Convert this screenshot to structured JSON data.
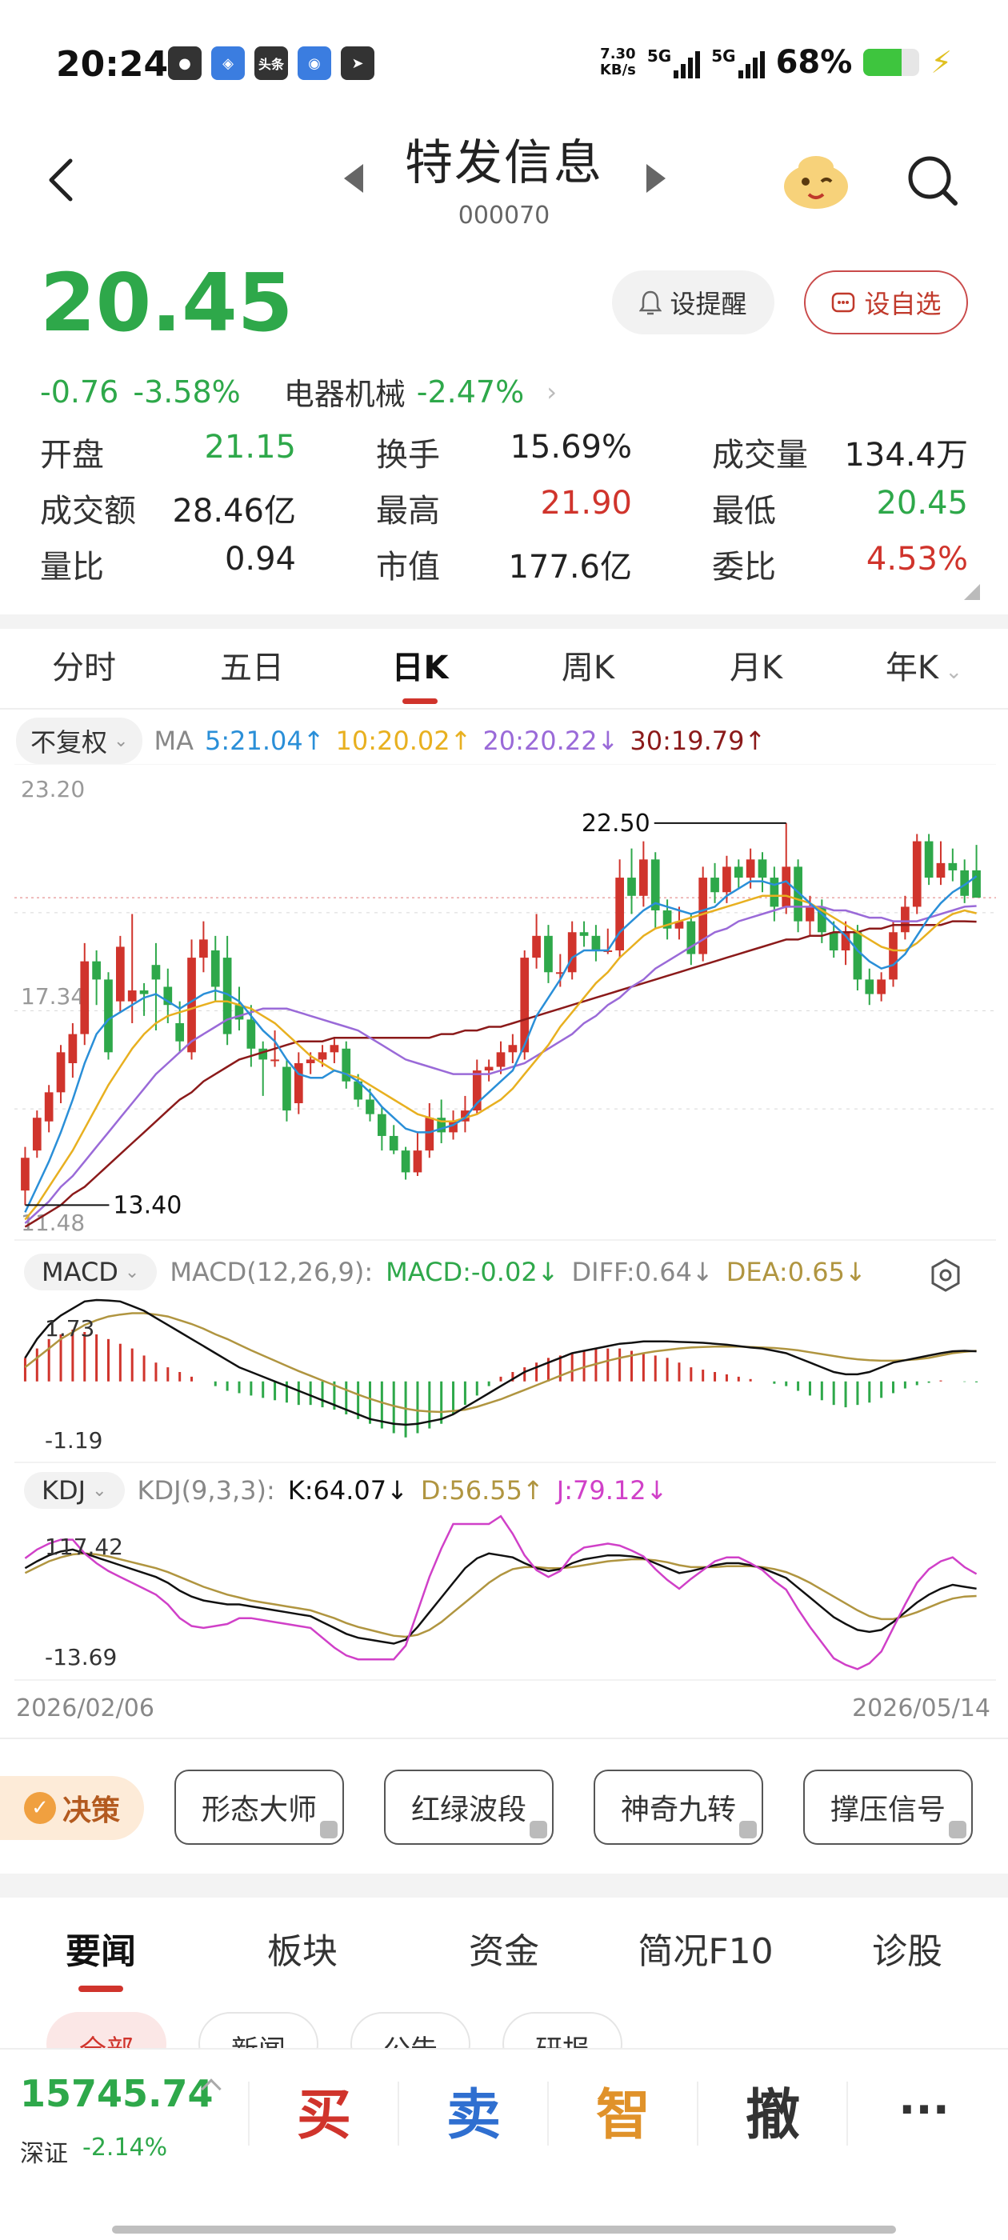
{
  "status_bar": {
    "time": "20:24",
    "net_speed_value": "7.30",
    "net_speed_unit": "KB/s",
    "signal1": "5G",
    "signal2": "5G",
    "battery_percent": "68%",
    "battery_level": 0.68,
    "apps": [
      "wechat-icon",
      "alipay-icon",
      "toutiao-icon",
      "browser-icon",
      "telegram-icon"
    ],
    "toutiao_label": "头条"
  },
  "header": {
    "name": "特发信息",
    "code": "000070"
  },
  "quote": {
    "price": "20.45",
    "change": "-0.76",
    "change_pct": "-3.58%",
    "sector": "电器机械",
    "sector_pct": "-2.47%",
    "alert_label": "设提醒",
    "watch_label": "设自选"
  },
  "stats": [
    [
      {
        "label": "开盘",
        "value": "21.15",
        "color": "green"
      },
      {
        "label": "换手",
        "value": "15.69%",
        "color": "dark"
      },
      {
        "label": "成交量",
        "value": "134.4万",
        "color": "dark"
      }
    ],
    [
      {
        "label": "成交额",
        "value": "28.46亿",
        "color": "dark"
      },
      {
        "label": "最高",
        "value": "21.90",
        "color": "red"
      },
      {
        "label": "最低",
        "value": "20.45",
        "color": "green"
      }
    ],
    [
      {
        "label": "量比",
        "value": "0.94",
        "color": "dark"
      },
      {
        "label": "市值",
        "value": "177.6亿",
        "color": "dark"
      },
      {
        "label": "委比",
        "value": "4.53%",
        "color": "red"
      }
    ]
  ],
  "period_tabs": [
    "分时",
    "五日",
    "日K",
    "周K",
    "月K",
    "年K"
  ],
  "active_period": "日K",
  "ma": {
    "adj": "不复权",
    "label": "MA",
    "ma5": "5:21.04↑",
    "ma10": "10:20.02↑",
    "ma20": "20:20.22↓",
    "ma30": "30:19.79↑"
  },
  "chart_data": {
    "type": "candlestick",
    "price_axis": {
      "top": "23.20",
      "mid": "17.34",
      "bottom": "11.48",
      "min": 11.48,
      "max": 23.2
    },
    "high_label": "22.50",
    "low_label": "13.40",
    "candles": [
      [
        12.4,
        13.3,
        12.0,
        13.6
      ],
      [
        13.5,
        14.4,
        13.3,
        14.6
      ],
      [
        14.3,
        15.1,
        14.0,
        15.3
      ],
      [
        15.1,
        16.2,
        14.8,
        16.4
      ],
      [
        15.9,
        16.7,
        15.5,
        17.0
      ],
      [
        16.7,
        18.7,
        16.4,
        19.2
      ],
      [
        18.7,
        18.2,
        17.5,
        19.0
      ],
      [
        18.2,
        16.2,
        16.0,
        18.4
      ],
      [
        17.6,
        19.1,
        17.3,
        19.4
      ],
      [
        17.6,
        17.9,
        17.0,
        20.0
      ],
      [
        17.9,
        17.8,
        17.2,
        18.1
      ],
      [
        18.6,
        18.2,
        16.8,
        19.2
      ],
      [
        18.0,
        17.5,
        17.0,
        18.5
      ],
      [
        17.0,
        16.5,
        16.2,
        17.6
      ],
      [
        16.2,
        18.8,
        16.0,
        19.3
      ],
      [
        18.8,
        19.3,
        18.4,
        19.8
      ],
      [
        19.0,
        18.0,
        17.6,
        19.4
      ],
      [
        18.8,
        16.7,
        16.4,
        19.4
      ],
      [
        17.5,
        17.1,
        16.8,
        18.0
      ],
      [
        17.1,
        16.3,
        15.8,
        17.5
      ],
      [
        16.3,
        16.0,
        15.0,
        16.5
      ],
      [
        16.0,
        16.0,
        15.8,
        16.8
      ],
      [
        15.8,
        14.6,
        14.3,
        16.0
      ],
      [
        14.8,
        15.9,
        14.5,
        16.2
      ],
      [
        15.9,
        16.0,
        15.6,
        16.2
      ],
      [
        16.0,
        16.2,
        15.8,
        16.4
      ],
      [
        16.2,
        16.4,
        15.9,
        16.6
      ],
      [
        16.3,
        15.4,
        15.2,
        16.5
      ],
      [
        15.4,
        14.9,
        14.7,
        15.6
      ],
      [
        14.9,
        14.5,
        14.3,
        15.2
      ],
      [
        14.5,
        13.9,
        13.5,
        14.7
      ],
      [
        13.9,
        13.5,
        13.4,
        14.2
      ],
      [
        13.5,
        12.9,
        12.7,
        13.6
      ],
      [
        12.9,
        13.5,
        12.8,
        14.0
      ],
      [
        13.5,
        14.4,
        13.3,
        14.8
      ],
      [
        14.4,
        14.0,
        13.7,
        14.9
      ],
      [
        14.0,
        14.3,
        13.8,
        14.6
      ],
      [
        14.3,
        14.6,
        14.0,
        15.0
      ],
      [
        14.6,
        15.7,
        14.5,
        16.0
      ],
      [
        15.7,
        15.8,
        15.4,
        16.0
      ],
      [
        15.8,
        16.2,
        15.6,
        16.5
      ],
      [
        16.2,
        16.4,
        15.9,
        16.7
      ],
      [
        16.2,
        18.8,
        16.0,
        19.0
      ],
      [
        18.8,
        19.4,
        18.5,
        20.0
      ],
      [
        19.4,
        18.4,
        18.1,
        19.7
      ],
      [
        18.4,
        18.4,
        18.0,
        18.9
      ],
      [
        18.4,
        19.5,
        18.2,
        19.8
      ],
      [
        19.5,
        19.4,
        19.1,
        19.8
      ],
      [
        19.4,
        19.0,
        18.7,
        19.7
      ],
      [
        19.0,
        19.0,
        18.9,
        19.6
      ],
      [
        19.0,
        21.0,
        18.8,
        21.5
      ],
      [
        21.0,
        20.5,
        20.0,
        21.8
      ],
      [
        20.5,
        21.5,
        20.2,
        22.0
      ],
      [
        21.5,
        20.1,
        19.6,
        21.7
      ],
      [
        20.1,
        19.6,
        19.3,
        20.4
      ],
      [
        19.6,
        19.8,
        19.3,
        20.2
      ],
      [
        19.8,
        18.9,
        18.6,
        20.0
      ],
      [
        18.9,
        21.0,
        18.7,
        21.3
      ],
      [
        21.0,
        20.6,
        20.3,
        21.4
      ],
      [
        20.6,
        21.3,
        20.3,
        21.6
      ],
      [
        21.3,
        21.0,
        20.7,
        21.5
      ],
      [
        21.0,
        21.5,
        20.7,
        21.8
      ],
      [
        21.5,
        21.0,
        20.6,
        21.7
      ],
      [
        21.0,
        20.2,
        19.8,
        21.3
      ],
      [
        20.2,
        21.3,
        20.0,
        22.5
      ],
      [
        21.3,
        19.8,
        19.5,
        21.5
      ],
      [
        19.8,
        20.2,
        19.4,
        20.5
      ],
      [
        20.2,
        19.5,
        19.2,
        20.4
      ],
      [
        19.5,
        19.0,
        18.8,
        19.8
      ],
      [
        19.0,
        19.5,
        18.6,
        19.8
      ],
      [
        19.5,
        18.2,
        17.9,
        19.7
      ],
      [
        18.2,
        17.8,
        17.5,
        18.5
      ],
      [
        17.8,
        18.2,
        17.6,
        18.4
      ],
      [
        18.2,
        19.5,
        18.0,
        19.8
      ],
      [
        19.5,
        20.2,
        19.3,
        20.5
      ],
      [
        20.2,
        22.0,
        20.0,
        22.2
      ],
      [
        22.0,
        21.0,
        20.8,
        22.2
      ],
      [
        21.0,
        21.4,
        20.8,
        22.0
      ],
      [
        21.4,
        21.2,
        20.9,
        21.8
      ],
      [
        21.2,
        20.5,
        20.3,
        21.5
      ],
      [
        21.2,
        20.45,
        20.45,
        21.9
      ]
    ],
    "ma5": [
      11.8,
      12.5,
      13.2,
      14.0,
      14.9,
      15.9,
      16.7,
      17.1,
      17.3,
      17.5,
      17.7,
      17.8,
      17.6,
      17.4,
      17.6,
      17.8,
      17.9,
      17.8,
      17.6,
      17.2,
      16.8,
      16.5,
      16.0,
      15.6,
      15.5,
      15.5,
      15.7,
      15.6,
      15.4,
      15.1,
      14.7,
      14.4,
      14.1,
      14.0,
      14.0,
      14.1,
      14.2,
      14.4,
      14.8,
      15.1,
      15.4,
      15.7,
      16.4,
      17.2,
      17.7,
      18.2,
      18.8,
      19.0,
      19.0,
      19.0,
      19.5,
      19.8,
      20.1,
      20.3,
      20.2,
      20.1,
      20.0,
      20.1,
      20.2,
      20.5,
      20.7,
      20.9,
      20.9,
      20.8,
      20.9,
      20.6,
      20.3,
      20.0,
      19.7,
      19.4,
      19.0,
      18.7,
      18.5,
      18.6,
      18.9,
      19.4,
      19.9,
      20.3,
      20.6,
      20.8,
      21.04
    ],
    "ma10": [
      11.6,
      12.0,
      12.5,
      13.0,
      13.5,
      14.1,
      14.7,
      15.3,
      15.8,
      16.3,
      16.7,
      17.0,
      17.2,
      17.3,
      17.4,
      17.5,
      17.6,
      17.6,
      17.5,
      17.4,
      17.2,
      17.0,
      16.7,
      16.4,
      16.1,
      15.9,
      15.7,
      15.6,
      15.5,
      15.3,
      15.1,
      14.9,
      14.7,
      14.5,
      14.4,
      14.3,
      14.3,
      14.4,
      14.5,
      14.7,
      14.9,
      15.2,
      15.6,
      16.0,
      16.4,
      16.9,
      17.3,
      17.7,
      18.1,
      18.4,
      18.8,
      19.1,
      19.4,
      19.6,
      19.7,
      19.8,
      19.9,
      20.0,
      20.1,
      20.2,
      20.3,
      20.4,
      20.5,
      20.5,
      20.5,
      20.4,
      20.3,
      20.1,
      19.9,
      19.7,
      19.5,
      19.3,
      19.1,
      19.0,
      19.0,
      19.2,
      19.5,
      19.8,
      20.0,
      20.1,
      20.02
    ],
    "ma20": [
      11.5,
      11.8,
      12.1,
      12.5,
      12.8,
      13.2,
      13.6,
      14.0,
      14.4,
      14.8,
      15.2,
      15.6,
      15.9,
      16.2,
      16.5,
      16.7,
      16.9,
      17.1,
      17.2,
      17.3,
      17.4,
      17.4,
      17.4,
      17.3,
      17.2,
      17.1,
      17.0,
      16.9,
      16.8,
      16.6,
      16.4,
      16.2,
      16.0,
      15.9,
      15.8,
      15.7,
      15.6,
      15.6,
      15.6,
      15.6,
      15.7,
      15.8,
      15.9,
      16.1,
      16.3,
      16.5,
      16.7,
      17.0,
      17.2,
      17.5,
      17.7,
      18.0,
      18.2,
      18.5,
      18.7,
      18.9,
      19.1,
      19.3,
      19.5,
      19.6,
      19.8,
      19.9,
      20.0,
      20.1,
      20.2,
      20.2,
      20.2,
      20.2,
      20.1,
      20.1,
      20.0,
      19.9,
      19.9,
      19.8,
      19.8,
      19.8,
      19.9,
      20.0,
      20.1,
      20.2,
      20.22
    ],
    "ma30": [
      11.4,
      11.6,
      11.8,
      12.0,
      12.3,
      12.5,
      12.8,
      13.1,
      13.4,
      13.7,
      14.0,
      14.3,
      14.6,
      14.9,
      15.1,
      15.4,
      15.6,
      15.8,
      16.0,
      16.1,
      16.2,
      16.3,
      16.4,
      16.5,
      16.5,
      16.5,
      16.6,
      16.6,
      16.6,
      16.6,
      16.6,
      16.6,
      16.6,
      16.6,
      16.6,
      16.7,
      16.7,
      16.8,
      16.8,
      16.9,
      16.9,
      17.0,
      17.1,
      17.2,
      17.3,
      17.4,
      17.5,
      17.6,
      17.7,
      17.8,
      17.9,
      18.0,
      18.1,
      18.2,
      18.3,
      18.4,
      18.5,
      18.6,
      18.7,
      18.8,
      18.9,
      19.0,
      19.1,
      19.2,
      19.3,
      19.3,
      19.4,
      19.4,
      19.5,
      19.5,
      19.5,
      19.6,
      19.6,
      19.7,
      19.7,
      19.7,
      19.7,
      19.7,
      19.8,
      19.8,
      19.79
    ],
    "macd": {
      "label": "MACD",
      "params": "MACD(12,26,9):",
      "macd_val": "MACD:-0.02↓",
      "diff_val": "DIFF:0.64↓",
      "dea_val": "DEA:0.65↓",
      "top": "1.73",
      "bottom": "-1.19",
      "min": -1.5,
      "max": 1.9,
      "hist": [
        0.5,
        0.7,
        0.9,
        1.0,
        1.1,
        1.05,
        1.0,
        0.9,
        0.8,
        0.7,
        0.55,
        0.4,
        0.3,
        0.2,
        0.1,
        0.0,
        -0.1,
        -0.2,
        -0.25,
        -0.3,
        -0.35,
        -0.4,
        -0.45,
        -0.5,
        -0.5,
        -0.55,
        -0.6,
        -0.7,
        -0.8,
        -0.9,
        -1.0,
        -1.1,
        -1.19,
        -1.1,
        -1.0,
        -0.9,
        -0.7,
        -0.5,
        -0.3,
        -0.1,
        0.1,
        0.2,
        0.3,
        0.4,
        0.5,
        0.55,
        0.6,
        0.65,
        0.7,
        0.7,
        0.7,
        0.65,
        0.6,
        0.55,
        0.5,
        0.4,
        0.3,
        0.25,
        0.2,
        0.15,
        0.1,
        0.05,
        0.0,
        -0.05,
        -0.1,
        -0.2,
        -0.3,
        -0.4,
        -0.5,
        -0.55,
        -0.5,
        -0.45,
        -0.35,
        -0.25,
        -0.15,
        -0.08,
        -0.03,
        0.02,
        0.0,
        -0.01,
        -0.02
      ],
      "diff": [
        0.5,
        0.9,
        1.2,
        1.4,
        1.55,
        1.7,
        1.73,
        1.72,
        1.7,
        1.6,
        1.5,
        1.35,
        1.2,
        1.05,
        0.9,
        0.75,
        0.6,
        0.45,
        0.3,
        0.2,
        0.1,
        0.0,
        -0.1,
        -0.2,
        -0.3,
        -0.4,
        -0.5,
        -0.6,
        -0.7,
        -0.8,
        -0.85,
        -0.9,
        -0.92,
        -0.9,
        -0.85,
        -0.8,
        -0.7,
        -0.55,
        -0.4,
        -0.25,
        -0.1,
        0.05,
        0.2,
        0.3,
        0.4,
        0.5,
        0.6,
        0.65,
        0.7,
        0.75,
        0.8,
        0.82,
        0.85,
        0.85,
        0.85,
        0.84,
        0.83,
        0.82,
        0.8,
        0.78,
        0.75,
        0.72,
        0.7,
        0.65,
        0.6,
        0.5,
        0.4,
        0.3,
        0.2,
        0.15,
        0.15,
        0.2,
        0.3,
        0.4,
        0.45,
        0.5,
        0.55,
        0.6,
        0.64,
        0.65,
        0.64
      ],
      "dea": [
        0.3,
        0.5,
        0.7,
        0.9,
        1.05,
        1.2,
        1.3,
        1.38,
        1.42,
        1.45,
        1.45,
        1.42,
        1.38,
        1.3,
        1.22,
        1.12,
        1.0,
        0.9,
        0.78,
        0.66,
        0.55,
        0.44,
        0.33,
        0.22,
        0.12,
        0.02,
        -0.08,
        -0.18,
        -0.28,
        -0.37,
        -0.45,
        -0.52,
        -0.58,
        -0.62,
        -0.64,
        -0.65,
        -0.63,
        -0.6,
        -0.54,
        -0.46,
        -0.38,
        -0.28,
        -0.18,
        -0.08,
        0.02,
        0.12,
        0.22,
        0.3,
        0.37,
        0.44,
        0.5,
        0.55,
        0.6,
        0.64,
        0.67,
        0.7,
        0.72,
        0.73,
        0.74,
        0.74,
        0.74,
        0.73,
        0.72,
        0.71,
        0.69,
        0.66,
        0.62,
        0.58,
        0.54,
        0.5,
        0.47,
        0.45,
        0.44,
        0.44,
        0.45,
        0.47,
        0.5,
        0.55,
        0.6,
        0.63,
        0.65
      ]
    },
    "kdj": {
      "label": "KDJ",
      "params": "KDJ(9,3,3):",
      "k_val": "K:64.07↓",
      "d_val": "D:56.55↑",
      "j_val": "J:79.12↓",
      "top": "117.42",
      "bottom": "-13.69",
      "min": -25,
      "max": 130,
      "k": [
        85,
        92,
        98,
        102,
        104,
        100,
        96,
        92,
        88,
        84,
        80,
        76,
        70,
        62,
        56,
        52,
        50,
        48,
        48,
        46,
        44,
        42,
        40,
        38,
        36,
        30,
        24,
        18,
        14,
        12,
        10,
        8,
        12,
        25,
        40,
        55,
        70,
        85,
        95,
        100,
        98,
        96,
        90,
        85,
        82,
        84,
        90,
        94,
        96,
        98,
        98,
        97,
        95,
        90,
        85,
        80,
        82,
        85,
        88,
        90,
        90,
        88,
        85,
        80,
        75,
        65,
        55,
        45,
        35,
        28,
        22,
        20,
        22,
        30,
        40,
        50,
        58,
        64,
        68,
        66,
        64.07
      ],
      "d": [
        80,
        86,
        92,
        96,
        99,
        100,
        99,
        97,
        94,
        91,
        88,
        85,
        81,
        76,
        71,
        66,
        62,
        58,
        55,
        52,
        50,
        48,
        46,
        44,
        42,
        38,
        34,
        29,
        25,
        22,
        19,
        16,
        15,
        17,
        22,
        30,
        40,
        50,
        60,
        70,
        78,
        84,
        86,
        86,
        85,
        85,
        86,
        88,
        90,
        92,
        93,
        94,
        94,
        93,
        91,
        88,
        86,
        86,
        86,
        87,
        87,
        87,
        86,
        84,
        81,
        76,
        70,
        63,
        56,
        49,
        42,
        36,
        33,
        33,
        36,
        40,
        45,
        50,
        54,
        56,
        56.55
      ],
      "j": [
        95,
        104,
        110,
        114,
        114,
        100,
        90,
        82,
        76,
        70,
        64,
        58,
        48,
        34,
        26,
        24,
        26,
        28,
        34,
        34,
        32,
        30,
        28,
        26,
        24,
        14,
        4,
        -4,
        -8,
        -8,
        -8,
        -8,
        6,
        41,
        76,
        105,
        130,
        130,
        130,
        130,
        138,
        120,
        98,
        83,
        76,
        82,
        98,
        106,
        108,
        110,
        108,
        103,
        97,
        84,
        73,
        64,
        74,
        83,
        92,
        96,
        96,
        90,
        83,
        72,
        63,
        43,
        25,
        9,
        -7,
        -13.69,
        -18,
        -12,
        0,
        24,
        48,
        70,
        84,
        92,
        96,
        86,
        79.12
      ]
    },
    "date_start": "2026/02/06",
    "date_end": "2026/05/14"
  },
  "decision": {
    "label": "决策",
    "tools": [
      "形态大师",
      "红绿波段",
      "神奇九转",
      "撑压信号"
    ]
  },
  "news_tabs": [
    "要闻",
    "板块",
    "资金",
    "简况F10",
    "诊股"
  ],
  "active_news_tab": "要闻",
  "news_subtabs": [
    "全部",
    "新闻",
    "公告",
    "研报"
  ],
  "bottom_bar": {
    "index_value": "15745.74",
    "index_name": "深证",
    "index_change": "-2.14%",
    "buy": "买",
    "sell": "卖",
    "smart": "智",
    "cancel": "撤",
    "more": "···"
  },
  "colors": {
    "up": "#d0342c",
    "down": "#2ea84a",
    "ma5": "#2a8fd8",
    "ma10": "#e8b020",
    "ma20": "#9a6ad8",
    "ma30": "#8b1a1a",
    "diff": "#111111",
    "dea": "#b09540",
    "kdj_k": "#111111",
    "kdj_d": "#b09540",
    "kdj_j": "#d040c8"
  }
}
